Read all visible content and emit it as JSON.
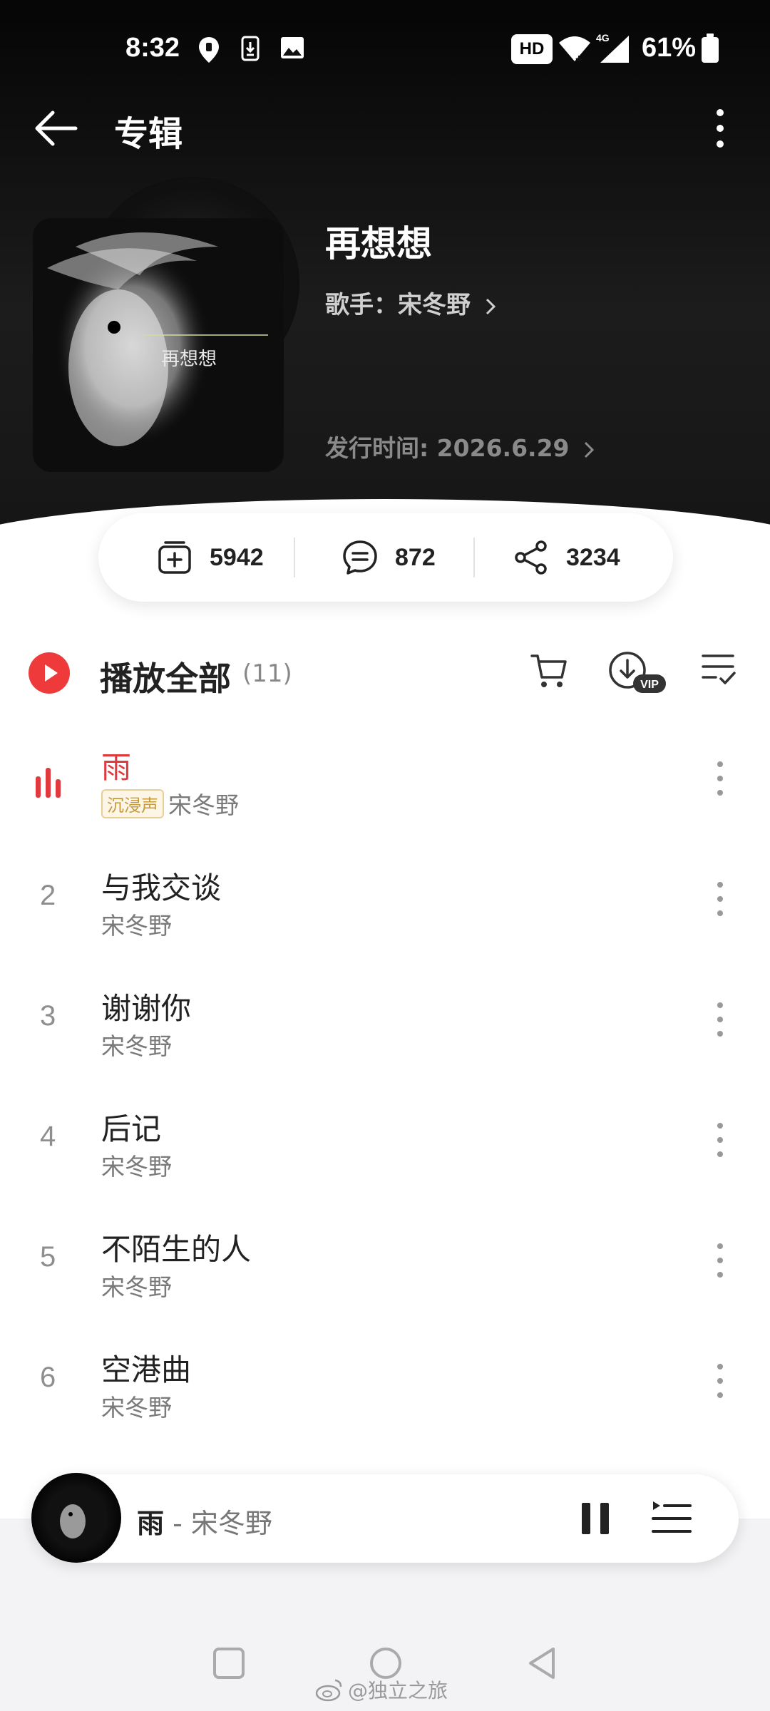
{
  "status_bar": {
    "time": "8:32",
    "hd": "HD",
    "network": "4G",
    "battery": "61%"
  },
  "topbar": {
    "title": "专辑"
  },
  "album": {
    "name": "再想想",
    "artist_label": "歌手：宋冬野",
    "release_label": "发行时间: 2026.6.29",
    "cover_text": "再想想"
  },
  "stats": {
    "collect": "5942",
    "comments": "872",
    "share": "3234"
  },
  "play_all": {
    "label": "播放全部",
    "count": "(11)"
  },
  "tracks": [
    {
      "num": "",
      "title": "雨",
      "badge": "沉浸声",
      "artist": "宋冬野",
      "playing": true
    },
    {
      "num": "2",
      "title": "与我交谈",
      "badge": "",
      "artist": "宋冬野",
      "playing": false
    },
    {
      "num": "3",
      "title": "谢谢你",
      "badge": "",
      "artist": "宋冬野",
      "playing": false
    },
    {
      "num": "4",
      "title": "后记",
      "badge": "",
      "artist": "宋冬野",
      "playing": false
    },
    {
      "num": "5",
      "title": "不陌生的人",
      "badge": "",
      "artist": "宋冬野",
      "playing": false
    },
    {
      "num": "6",
      "title": "空港曲",
      "badge": "",
      "artist": "宋冬野",
      "playing": false
    }
  ],
  "mini_player": {
    "song": "雨",
    "separator": " - ",
    "artist": "宋冬野"
  },
  "watermark": "@独立之旅",
  "colors": {
    "accent_red": "#e0393e",
    "hero_dark": "#151515"
  }
}
